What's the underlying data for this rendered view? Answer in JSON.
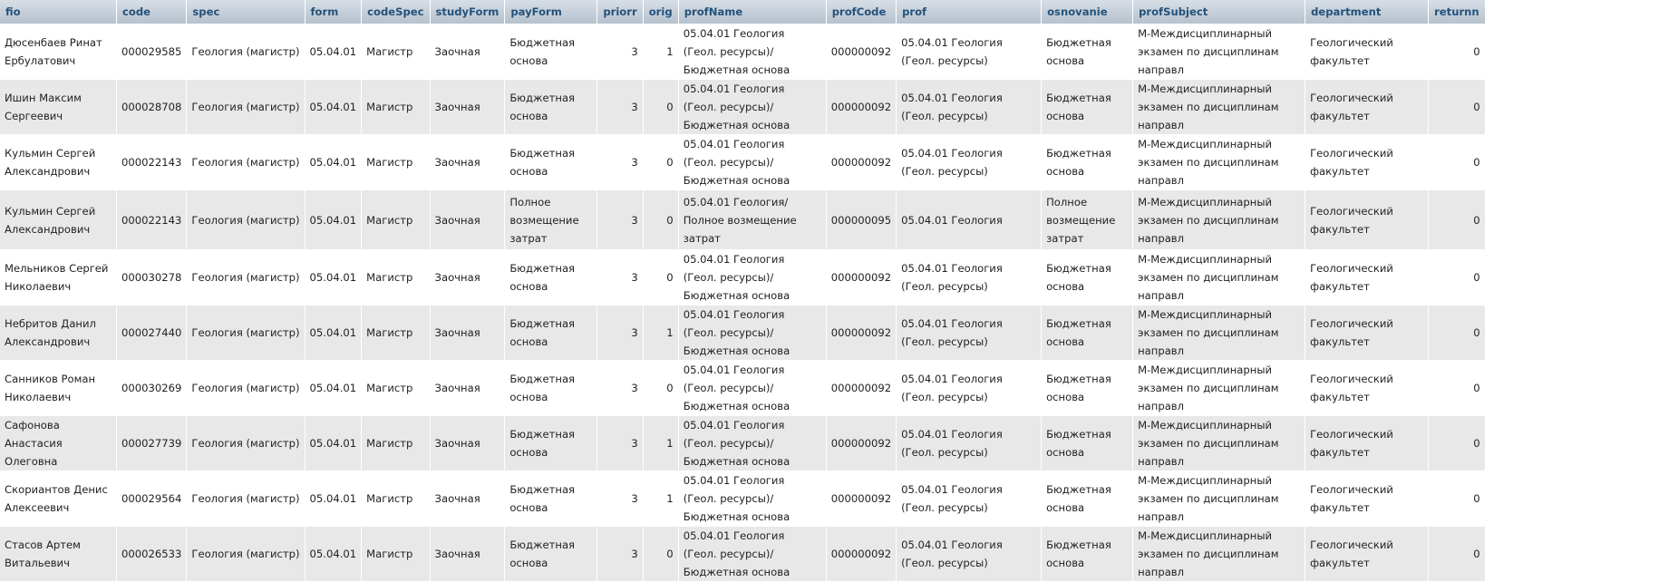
{
  "table": {
    "columns": [
      "fio",
      "code",
      "spec",
      "form",
      "codeSpec",
      "studyForm",
      "payForm",
      "priorr",
      "orig",
      "profName",
      "profCode",
      "prof",
      "osnovanie",
      "profSubject",
      "department",
      "returnn"
    ],
    "rows": [
      {
        "fio": "Дюсенбаев Ринат Ербулатович",
        "code": "000029585",
        "spec": "Геология (магистр)",
        "form": "05.04.01",
        "codeSpec": "Магистр",
        "studyForm": "Заочная",
        "payForm": "Бюджетная основа",
        "priorr": "3",
        "orig": "1",
        "profName": "05.04.01 Геология (Геол. ресурсы)/Бюджетная основа",
        "profCode": "000000092",
        "prof": "05.04.01 Геология (Геол. ресурсы)",
        "osnovanie": "Бюджетная основа",
        "profSubject": "М-Междисциплинарный экзамен по дисциплинам направл",
        "department": "Геологический факультет",
        "returnn": "0"
      },
      {
        "fio": "Ишин Максим Сергеевич",
        "code": "000028708",
        "spec": "Геология (магистр)",
        "form": "05.04.01",
        "codeSpec": "Магистр",
        "studyForm": "Заочная",
        "payForm": "Бюджетная основа",
        "priorr": "3",
        "orig": "0",
        "profName": "05.04.01 Геология (Геол. ресурсы)/Бюджетная основа",
        "profCode": "000000092",
        "prof": "05.04.01 Геология (Геол. ресурсы)",
        "osnovanie": "Бюджетная основа",
        "profSubject": "М-Междисциплинарный экзамен по дисциплинам направл",
        "department": "Геологический факультет",
        "returnn": "0"
      },
      {
        "fio": "Кульмин Сергей Александрович",
        "code": "000022143",
        "spec": "Геология (магистр)",
        "form": "05.04.01",
        "codeSpec": "Магистр",
        "studyForm": "Заочная",
        "payForm": "Бюджетная основа",
        "priorr": "3",
        "orig": "0",
        "profName": "05.04.01 Геология (Геол. ресурсы)/Бюджетная основа",
        "profCode": "000000092",
        "prof": "05.04.01 Геология (Геол. ресурсы)",
        "osnovanie": "Бюджетная основа",
        "profSubject": "М-Междисциплинарный экзамен по дисциплинам направл",
        "department": "Геологический факультет",
        "returnn": "0"
      },
      {
        "fio": "Кульмин Сергей Александрович",
        "code": "000022143",
        "spec": "Геология (магистр)",
        "form": "05.04.01",
        "codeSpec": "Магистр",
        "studyForm": "Заочная",
        "payForm": "Полное возмещение затрат",
        "priorr": "3",
        "orig": "0",
        "profName": "05.04.01 Геология/Полное возмещение затрат",
        "profCode": "000000095",
        "prof": "05.04.01 Геология",
        "osnovanie": "Полное возмещение затрат",
        "profSubject": "М-Междисциплинарный экзамен по дисциплинам направл",
        "department": "Геологический факультет",
        "returnn": "0"
      },
      {
        "fio": "Мельников Сергей Николаевич",
        "code": "000030278",
        "spec": "Геология (магистр)",
        "form": "05.04.01",
        "codeSpec": "Магистр",
        "studyForm": "Заочная",
        "payForm": "Бюджетная основа",
        "priorr": "3",
        "orig": "0",
        "profName": "05.04.01 Геология (Геол. ресурсы)/Бюджетная основа",
        "profCode": "000000092",
        "prof": "05.04.01 Геология (Геол. ресурсы)",
        "osnovanie": "Бюджетная основа",
        "profSubject": "М-Междисциплинарный экзамен по дисциплинам направл",
        "department": "Геологический факультет",
        "returnn": "0"
      },
      {
        "fio": "Небритов Данил Александрович",
        "code": "000027440",
        "spec": "Геология (магистр)",
        "form": "05.04.01",
        "codeSpec": "Магистр",
        "studyForm": "Заочная",
        "payForm": "Бюджетная основа",
        "priorr": "3",
        "orig": "1",
        "profName": "05.04.01 Геология (Геол. ресурсы)/Бюджетная основа",
        "profCode": "000000092",
        "prof": "05.04.01 Геология (Геол. ресурсы)",
        "osnovanie": "Бюджетная основа",
        "profSubject": "М-Междисциплинарный экзамен по дисциплинам направл",
        "department": "Геологический факультет",
        "returnn": "0"
      },
      {
        "fio": "Санников Роман Николаевич",
        "code": "000030269",
        "spec": "Геология (магистр)",
        "form": "05.04.01",
        "codeSpec": "Магистр",
        "studyForm": "Заочная",
        "payForm": "Бюджетная основа",
        "priorr": "3",
        "orig": "0",
        "profName": "05.04.01 Геология (Геол. ресурсы)/Бюджетная основа",
        "profCode": "000000092",
        "prof": "05.04.01 Геология (Геол. ресурсы)",
        "osnovanie": "Бюджетная основа",
        "profSubject": "М-Междисциплинарный экзамен по дисциплинам направл",
        "department": "Геологический факультет",
        "returnn": "0"
      },
      {
        "fio": "Сафонова Анастасия Олеговна",
        "code": "000027739",
        "spec": "Геология (магистр)",
        "form": "05.04.01",
        "codeSpec": "Магистр",
        "studyForm": "Заочная",
        "payForm": "Бюджетная основа",
        "priorr": "3",
        "orig": "1",
        "profName": "05.04.01 Геология (Геол. ресурсы)/Бюджетная основа",
        "profCode": "000000092",
        "prof": "05.04.01 Геология (Геол. ресурсы)",
        "osnovanie": "Бюджетная основа",
        "profSubject": "М-Междисциплинарный экзамен по дисциплинам направл",
        "department": "Геологический факультет",
        "returnn": "0"
      },
      {
        "fio": "Скориантов Денис Алексеевич",
        "code": "000029564",
        "spec": "Геология (магистр)",
        "form": "05.04.01",
        "codeSpec": "Магистр",
        "studyForm": "Заочная",
        "payForm": "Бюджетная основа",
        "priorr": "3",
        "orig": "1",
        "profName": "05.04.01 Геология (Геол. ресурсы)/Бюджетная основа",
        "profCode": "000000092",
        "prof": "05.04.01 Геология (Геол. ресурсы)",
        "osnovanie": "Бюджетная основа",
        "profSubject": "М-Междисциплинарный экзамен по дисциплинам направл",
        "department": "Геологический факультет",
        "returnn": "0"
      },
      {
        "fio": "Стасов Артем Витальевич",
        "code": "000026533",
        "spec": "Геология (магистр)",
        "form": "05.04.01",
        "codeSpec": "Магистр",
        "studyForm": "Заочная",
        "payForm": "Бюджетная основа",
        "priorr": "3",
        "orig": "0",
        "profName": "05.04.01 Геология (Геол. ресурсы)/Бюджетная основа",
        "profCode": "000000092",
        "prof": "05.04.01 Геология (Геол. ресурсы)",
        "osnovanie": "Бюджетная основа",
        "profSubject": "М-Междисциплинарный экзамен по дисциплинам направл",
        "department": "Геологический факультет",
        "returnn": "0"
      }
    ]
  }
}
